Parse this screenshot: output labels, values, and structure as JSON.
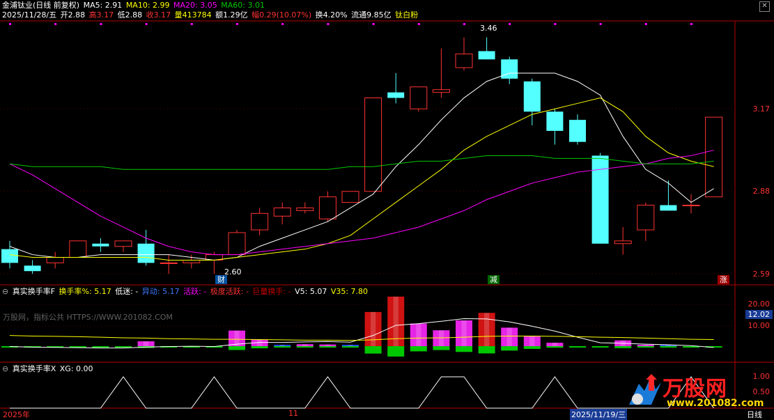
{
  "header": {
    "title": "金浦钛业(日线 前复权)",
    "ma5": "MA5: 2.91",
    "ma10": "MA10: 2.99",
    "ma20": "MA20: 3.05",
    "ma60": "MA60: 3.01",
    "date": "2025/11/28/五",
    "open": "开2.88",
    "high": "高3.17",
    "low": "低2.88",
    "close": "收3.17",
    "vol": "量413784",
    "amount": "额1.29亿",
    "change": "幅0.29(10.07%)",
    "turnover": "换4.20%",
    "float": "流通9.85亿",
    "concept": "钛白粉"
  },
  "colors": {
    "up": "#ff3232",
    "down": "#54ffff",
    "ma5": "#ffffff",
    "ma10": "#ffff00",
    "ma20": "#ff00ff",
    "ma60": "#00c800",
    "frame": "#b40000",
    "axis_text": "#ff3232"
  },
  "price_axis": [
    "3.17",
    "2.88",
    "2.59"
  ],
  "price_annotations": {
    "high": "3.46",
    "low": "2.60"
  },
  "markers": {
    "cai": "财",
    "jian": "减",
    "zhang": "涨"
  },
  "panel2": {
    "title": "真实换手率F",
    "turn_label": "换手率%: 5.17",
    "low_label": "低迷: -",
    "yidong": "异动: 5.17",
    "huoyue": "活跃: -",
    "jiduhuoyue": "极度活跃: -",
    "jiliang": "巨量换手: -",
    "v5": "V5: 5.07",
    "v35": "V35: 7.80",
    "watermark": "万股网，指标公共 HTTPS://WWW.201082.COM",
    "axis": [
      "20.00",
      "10.00"
    ],
    "current": "12.02"
  },
  "panel3": {
    "title": "真实换手率X",
    "xg": "XG: 0.00",
    "axis": [
      "1.00",
      "0.50"
    ]
  },
  "date_axis": [
    "2025年",
    "11",
    "2025/11/19/三",
    "日线"
  ],
  "brand": {
    "name": "万股网",
    "url": "www.201082.com"
  },
  "chart_data": [
    {
      "type": "candlestick",
      "title": "金浦钛业(日线 前复权)",
      "ylim": [
        2.56,
        3.52
      ],
      "tick_labels": [
        "3.17",
        "2.88",
        "2.59"
      ],
      "candles": [
        {
          "o": 2.69,
          "h": 2.72,
          "l": 2.62,
          "c": 2.64
        },
        {
          "o": 2.63,
          "h": 2.65,
          "l": 2.6,
          "c": 2.61
        },
        {
          "o": 2.64,
          "h": 2.68,
          "l": 2.62,
          "c": 2.66
        },
        {
          "o": 2.66,
          "h": 2.72,
          "l": 2.66,
          "c": 2.72
        },
        {
          "o": 2.71,
          "h": 2.73,
          "l": 2.68,
          "c": 2.7
        },
        {
          "o": 2.7,
          "h": 2.72,
          "l": 2.68,
          "c": 2.72
        },
        {
          "o": 2.71,
          "h": 2.76,
          "l": 2.63,
          "c": 2.64
        },
        {
          "o": 2.64,
          "h": 2.67,
          "l": 2.6,
          "c": 2.64
        },
        {
          "o": 2.64,
          "h": 2.67,
          "l": 2.62,
          "c": 2.65
        },
        {
          "o": 2.65,
          "h": 2.68,
          "l": 2.6,
          "c": 2.67
        },
        {
          "o": 2.67,
          "h": 2.76,
          "l": 2.67,
          "c": 2.75
        },
        {
          "o": 2.76,
          "h": 2.84,
          "l": 2.74,
          "c": 2.82
        },
        {
          "o": 2.81,
          "h": 2.86,
          "l": 2.78,
          "c": 2.84
        },
        {
          "o": 2.83,
          "h": 2.86,
          "l": 2.82,
          "c": 2.84
        },
        {
          "o": 2.8,
          "h": 2.9,
          "l": 2.79,
          "c": 2.88
        },
        {
          "o": 2.86,
          "h": 2.9,
          "l": 2.86,
          "c": 2.9
        },
        {
          "o": 2.9,
          "h": 3.24,
          "l": 2.9,
          "c": 3.24
        },
        {
          "o": 3.26,
          "h": 3.33,
          "l": 3.22,
          "c": 3.24
        },
        {
          "o": 3.2,
          "h": 3.28,
          "l": 3.19,
          "c": 3.28
        },
        {
          "o": 3.26,
          "h": 3.42,
          "l": 3.24,
          "c": 3.27
        },
        {
          "o": 3.35,
          "h": 3.46,
          "l": 3.34,
          "c": 3.4
        },
        {
          "o": 3.41,
          "h": 3.46,
          "l": 3.38,
          "c": 3.38
        },
        {
          "o": 3.38,
          "h": 3.39,
          "l": 3.29,
          "c": 3.31
        },
        {
          "o": 3.3,
          "h": 3.31,
          "l": 3.14,
          "c": 3.19
        },
        {
          "o": 3.19,
          "h": 3.2,
          "l": 3.07,
          "c": 3.12
        },
        {
          "o": 3.16,
          "h": 3.18,
          "l": 3.07,
          "c": 3.08
        },
        {
          "o": 3.03,
          "h": 3.04,
          "l": 2.71,
          "c": 2.71
        },
        {
          "o": 2.71,
          "h": 2.77,
          "l": 2.67,
          "c": 2.72
        },
        {
          "o": 2.76,
          "h": 2.86,
          "l": 2.72,
          "c": 2.85
        },
        {
          "o": 2.85,
          "h": 2.94,
          "l": 2.83,
          "c": 2.83
        },
        {
          "o": 2.85,
          "h": 2.89,
          "l": 2.82,
          "c": 2.85
        },
        {
          "o": 2.88,
          "h": 3.17,
          "l": 2.88,
          "c": 3.17
        }
      ],
      "series": [
        {
          "name": "MA5",
          "values": [
            2.7,
            2.67,
            2.66,
            2.66,
            2.67,
            2.67,
            2.67,
            2.67,
            2.66,
            2.65,
            2.66,
            2.7,
            2.73,
            2.76,
            2.79,
            2.84,
            2.89,
            2.99,
            3.07,
            3.16,
            3.24,
            3.3,
            3.33,
            3.33,
            3.33,
            3.3,
            3.25,
            3.1,
            2.98,
            2.93,
            2.86,
            2.91
          ]
        },
        {
          "name": "MA10",
          "values": [
            2.67,
            2.66,
            2.66,
            2.66,
            2.66,
            2.66,
            2.66,
            2.65,
            2.65,
            2.65,
            2.66,
            2.67,
            2.68,
            2.69,
            2.71,
            2.74,
            2.8,
            2.86,
            2.92,
            2.98,
            3.05,
            3.1,
            3.14,
            3.18,
            3.2,
            3.22,
            3.24,
            3.19,
            3.1,
            3.04,
            3.01,
            2.99
          ]
        },
        {
          "name": "MA20",
          "values": [
            3.0,
            2.96,
            2.91,
            2.86,
            2.81,
            2.77,
            2.73,
            2.7,
            2.68,
            2.67,
            2.67,
            2.68,
            2.69,
            2.7,
            2.71,
            2.72,
            2.73,
            2.75,
            2.77,
            2.8,
            2.83,
            2.87,
            2.9,
            2.93,
            2.95,
            2.97,
            2.98,
            2.99,
            3.0,
            3.02,
            3.03,
            3.05
          ]
        },
        {
          "name": "MA60",
          "values": [
            3.0,
            2.99,
            2.99,
            2.99,
            2.99,
            2.98,
            2.98,
            2.98,
            2.98,
            2.98,
            2.98,
            2.98,
            2.98,
            2.98,
            2.98,
            2.99,
            2.99,
            3.0,
            3.01,
            3.01,
            3.02,
            3.03,
            3.03,
            3.03,
            3.02,
            3.02,
            3.02,
            3.01,
            3.0,
            3.0,
            3.0,
            3.01
          ]
        }
      ]
    },
    {
      "type": "bar",
      "title": "真实换手率F",
      "ylim": [
        0,
        24
      ],
      "tick_labels": [
        "20.00",
        "10.00"
      ],
      "values": [
        5.0,
        4.8,
        5.1,
        5.0,
        4.6,
        4.6,
        7.2,
        4.9,
        4.6,
        5.0,
        10.9,
        7.8,
        6.0,
        6.2,
        6.1,
        6.0,
        17.3,
        22.6,
        13.3,
        11.0,
        14.4,
        17.0,
        11.9,
        8.9,
        6.7,
        5.4,
        4.4,
        7.5,
        6.0,
        6.0,
        4.5,
        5.17
      ],
      "kinds": [
        "blue",
        "blue",
        "blue",
        "blue",
        "blue",
        "blue",
        "magenta",
        "blue",
        "blue",
        "blue",
        "magenta",
        "magenta",
        "blue",
        "magenta",
        "magenta",
        "blue",
        "red",
        "red",
        "magenta",
        "magenta",
        "magenta",
        "red",
        "magenta",
        "magenta",
        "magenta",
        "blue",
        "blue",
        "magenta",
        "magenta",
        "blue",
        "blue",
        "blue"
      ],
      "series": [
        {
          "name": "V5",
          "values": [
            5.4,
            5.2,
            5.1,
            5.0,
            4.9,
            4.9,
            5.2,
            5.4,
            5.5,
            5.4,
            6.2,
            6.8,
            6.8,
            7.0,
            7.1,
            6.9,
            9.2,
            12.7,
            13.3,
            14.1,
            15.0,
            14.9,
            13.9,
            12.4,
            10.7,
            8.6,
            6.7,
            6.5,
            6.2,
            6.0,
            5.7,
            5.07
          ]
        },
        {
          "name": "V35",
          "values": [
            9.2,
            9.0,
            8.9,
            8.8,
            8.6,
            8.4,
            8.3,
            8.1,
            8.0,
            7.9,
            7.9,
            7.8,
            7.7,
            7.6,
            7.6,
            7.5,
            7.7,
            8.1,
            8.3,
            8.4,
            8.6,
            8.9,
            9.0,
            9.0,
            8.9,
            8.8,
            8.6,
            8.5,
            8.3,
            8.1,
            7.9,
            7.8
          ]
        }
      ]
    },
    {
      "type": "line",
      "title": "真实换手率X",
      "ylim": [
        0,
        1
      ],
      "tick_labels": [
        "1.00",
        "0.50"
      ],
      "values": [
        0,
        0,
        0,
        0,
        0,
        1,
        0,
        0,
        0,
        1,
        0,
        0,
        0,
        0,
        1,
        0,
        0,
        0,
        0,
        1,
        1,
        0,
        0,
        0,
        1,
        0,
        0,
        0,
        0,
        0,
        1,
        0
      ]
    }
  ]
}
